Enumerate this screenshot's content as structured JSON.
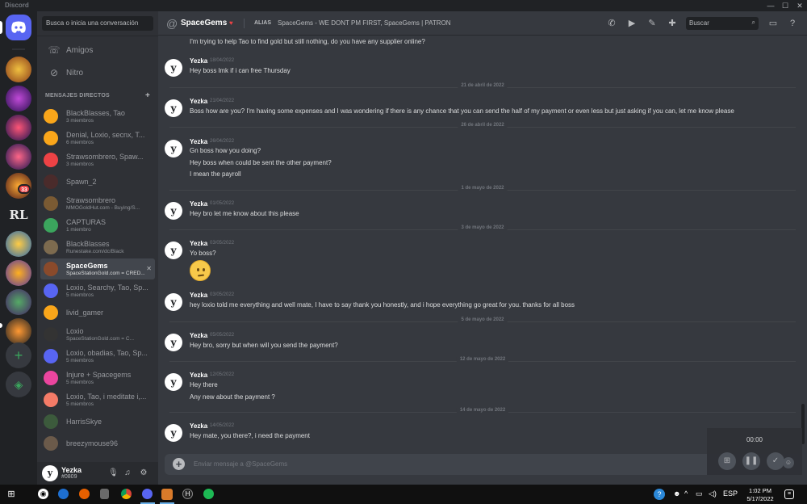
{
  "window": {
    "app_name": "Discord",
    "controls": [
      "—",
      "☐",
      "✕"
    ]
  },
  "search_conversation_placeholder": "Busca o inicia una conversación",
  "nav": [
    {
      "label": "Amigos",
      "icon": "friends-icon"
    },
    {
      "label": "Nitro",
      "icon": "nitro-icon"
    }
  ],
  "dm_header": "MENSAJES DIRECTOS",
  "server_badge": "33",
  "dms": [
    {
      "name": "BlackBlasses, Tao",
      "sub": "3 miembros",
      "color": "#faa61a"
    },
    {
      "name": "Denial, Loxio, secnx, T...",
      "sub": "6 miembros",
      "color": "#faa61a"
    },
    {
      "name": "Strawsombrero, Spaw...",
      "sub": "3 miembros",
      "color": "#ed4245"
    },
    {
      "name": "Spawn_2",
      "sub": "",
      "color": "#4a2b2b"
    },
    {
      "name": "Strawsombrero",
      "sub": "MMOGoldHut.com - Buying/S...",
      "color": "#7a5a33"
    },
    {
      "name": "CAPTURAS",
      "sub": "1 miembro",
      "color": "#3ba55d"
    },
    {
      "name": "BlackBlasses",
      "sub": "Runestake.com/dc/Black",
      "color": "#7d6b4f"
    },
    {
      "name": "SpaceGems",
      "sub": "SpaceStationGold.com = CRED...",
      "color": "#8a4a2b"
    },
    {
      "name": "Loxio, Searchy, Tao, Sp...",
      "sub": "5 miembros",
      "color": "#5865f2"
    },
    {
      "name": "livid_gamer",
      "sub": "",
      "color": "#faa61a"
    },
    {
      "name": "Loxio",
      "sub": "SpaceStationGold.com = C...",
      "color": "#333"
    },
    {
      "name": "Loxio, obadias, Tao, Sp...",
      "sub": "5 miembros",
      "color": "#5865f2"
    },
    {
      "name": "Injure + Spacegems",
      "sub": "5 miembros",
      "color": "#eb459e"
    },
    {
      "name": "Loxio, Tao, i meditate i,...",
      "sub": "5 miembros",
      "color": "#f47b67"
    },
    {
      "name": "HarrisSkye",
      "sub": "",
      "color": "#3c5a3c"
    },
    {
      "name": "breezymouse96",
      "sub": "",
      "color": "#6b5a4a"
    }
  ],
  "user": {
    "name": "Yezka",
    "tag": "#0809",
    "avatar": "y"
  },
  "chat": {
    "name": "SpaceGems",
    "alias_label": "ALIAS",
    "alias": "SpaceGems - WE DONT PM FIRST, SpaceGems | PATRON",
    "search_placeholder": "Buscar",
    "composer_placeholder": "Enviar mensaje a @SpaceGems"
  },
  "messages": {
    "top_line": "I'm trying to help Tao to find gold but still nothing, do you have any supplier online?",
    "m1": {
      "author": "Yezka",
      "date": "18/04/2022",
      "lines": [
        "Hey boss lmk if i can free Thursday"
      ]
    },
    "s1": "21 de abril de 2022",
    "m2": {
      "author": "Yezka",
      "date": "21/04/2022",
      "lines": [
        "Boss how are you? I'm having some expenses and I was wondering if there is any chance that you can send the half of my payment or even less but just asking if you can, let me know please"
      ]
    },
    "s2": "26 de abril de 2022",
    "m3": {
      "author": "Yezka",
      "date": "26/04/2022",
      "lines": [
        "Gn boss how you doing?",
        "Hey boss when could be sent the other payment?",
        "I mean the payroll"
      ]
    },
    "s3": "1 de mayo de 2022",
    "m4": {
      "author": "Yezka",
      "date": "01/05/2022",
      "lines": [
        "Hey bro let me know about this please"
      ]
    },
    "s4": "3 de mayo de 2022",
    "m5": {
      "author": "Yezka",
      "date": "03/05/2022",
      "lines": [
        "Yo boss?"
      ]
    },
    "m6": {
      "author": "Yezka",
      "date": "03/05/2022",
      "lines": [
        "hey loxio told me everything and well mate, I have to say thank you honestly, and i hope everything go great for you. thanks for all boss"
      ]
    },
    "s5": "5 de mayo de 2022",
    "m7": {
      "author": "Yezka",
      "date": "05/05/2022",
      "lines": [
        "Hey bro, sorry but when will you send the payment?"
      ]
    },
    "s6": "12 de mayo de 2022",
    "m8": {
      "author": "Yezka",
      "date": "12/05/2022",
      "lines": [
        "Hey there",
        "Any new about the payment ?"
      ]
    },
    "s7": "14 de mayo de 2022",
    "m9": {
      "author": "Yezka",
      "date": "14/05/2022",
      "lines": [
        "Hey mate, you there?, i need the payment"
      ]
    }
  },
  "recorder": {
    "time": "00:00"
  },
  "taskbar": {
    "lang": "ESP",
    "time": "1:02 PM",
    "date": "5/17/2022"
  }
}
